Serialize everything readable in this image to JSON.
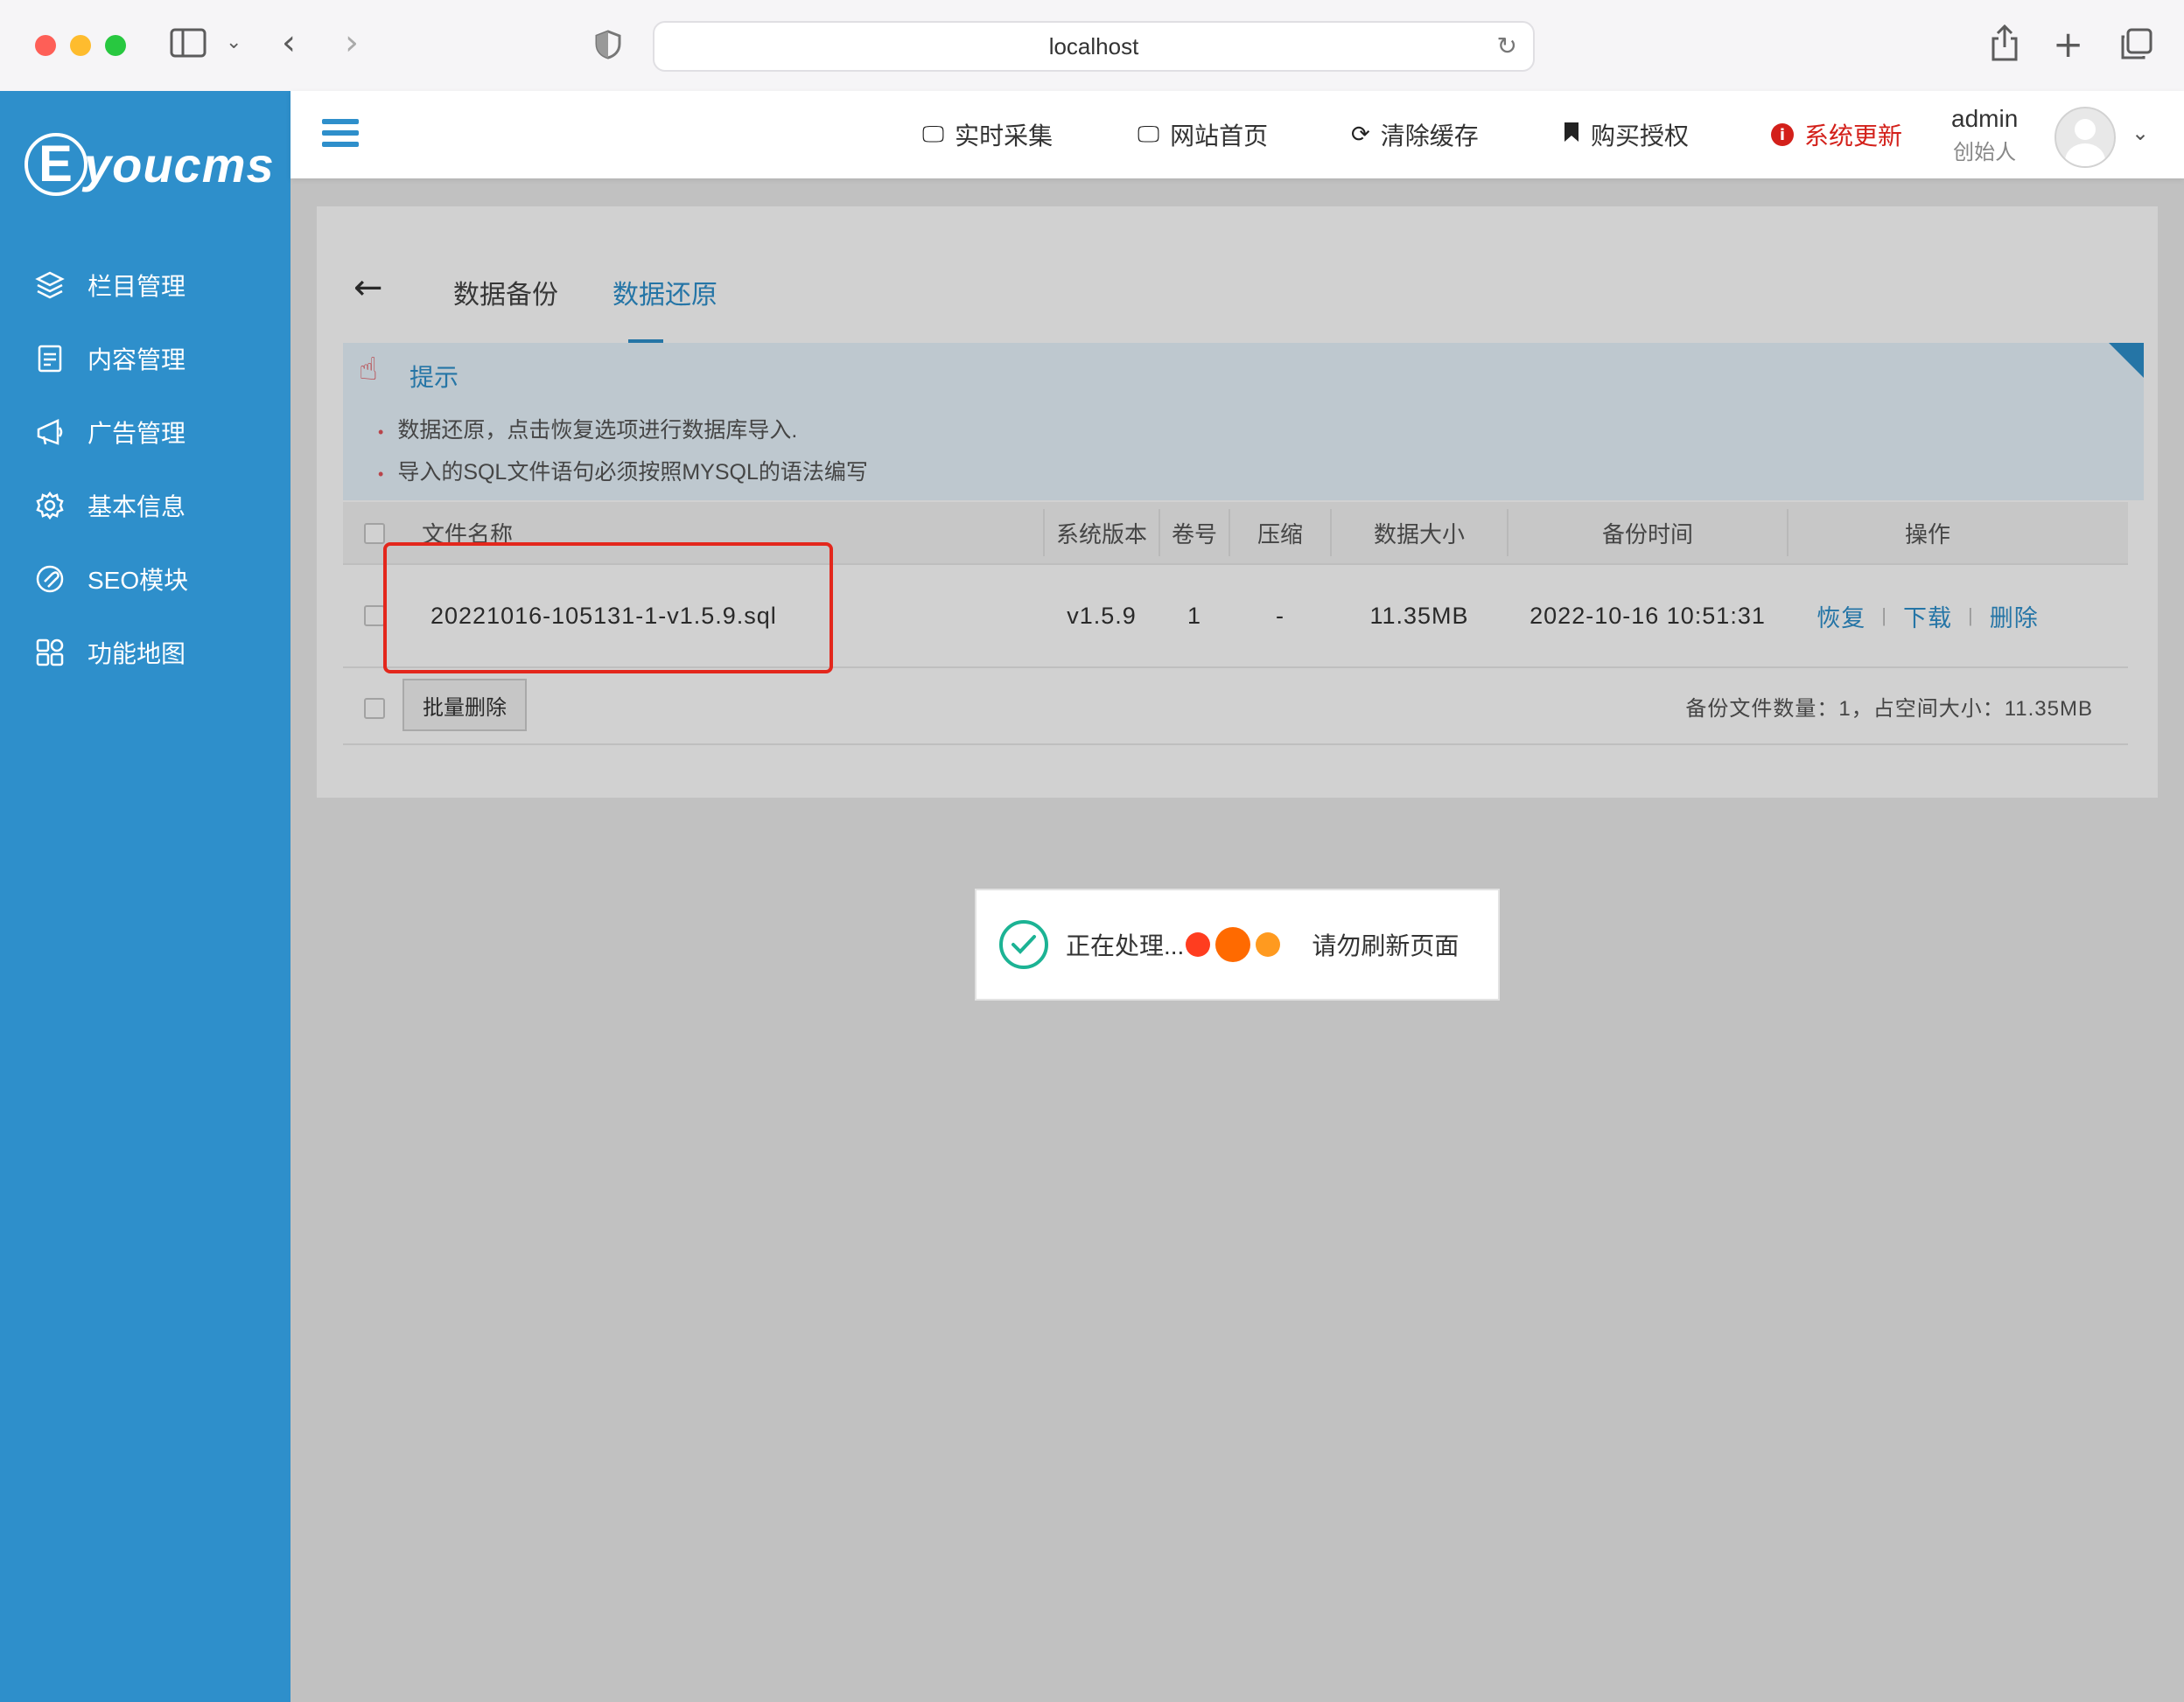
{
  "browser": {
    "url": "localhost"
  },
  "brand": {
    "logo_letter": "E",
    "logo_rest": "youcms",
    "color_primary": "#2e8fcb",
    "color_danger": "#d3201a"
  },
  "sidebar": {
    "items": [
      {
        "label": "栏目管理",
        "icon": "layers-icon"
      },
      {
        "label": "内容管理",
        "icon": "document-icon"
      },
      {
        "label": "广告管理",
        "icon": "ad-icon"
      },
      {
        "label": "基本信息",
        "icon": "gear-icon"
      },
      {
        "label": "SEO模块",
        "icon": "seo-icon"
      },
      {
        "label": "功能地图",
        "icon": "grid-icon"
      }
    ]
  },
  "header": {
    "links": [
      {
        "label": "实时采集",
        "icon": "monitor-icon"
      },
      {
        "label": "网站首页",
        "icon": "monitor-icon"
      },
      {
        "label": "清除缓存",
        "icon": "refresh-icon"
      },
      {
        "label": "购买授权",
        "icon": "bookmark-icon"
      },
      {
        "label": "系统更新",
        "icon": "info-icon"
      }
    ],
    "user_name": "admin",
    "user_role": "创始人"
  },
  "tabs": {
    "backup": "数据备份",
    "restore": "数据还原"
  },
  "tip": {
    "title": "提示",
    "lines": [
      "数据还原，点击恢复选项进行数据库导入.",
      "导入的SQL文件语句必须按照MYSQL的语法编写"
    ]
  },
  "table": {
    "headers": [
      "文件名称",
      "系统版本",
      "卷号",
      "压缩",
      "数据大小",
      "备份时间",
      "操作"
    ],
    "rows": [
      {
        "file_name": "20221016-105131-1-v1.5.9.sql",
        "version": "v1.5.9",
        "volume": "1",
        "compress": "-",
        "size": "11.35MB",
        "time": "2022-10-16 10:51:31",
        "actions": [
          "恢复",
          "下载",
          "删除"
        ]
      }
    ],
    "batch_delete": "批量删除",
    "summary": "备份文件数量：1，占空间大小：11.35MB"
  },
  "toast": {
    "text": "正在处理...",
    "text2": "请勿刷新页面"
  }
}
